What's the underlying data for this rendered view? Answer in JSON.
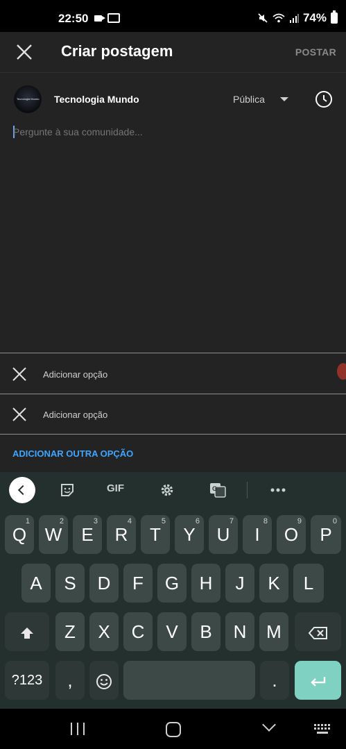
{
  "status_bar": {
    "time": "22:50",
    "battery": "74%",
    "notif_icon": "camera-icon, gallery-icon"
  },
  "app": {
    "title": "Criar postagem",
    "post_label": "POSTAR",
    "channel_name": "Tecnologia Mundo",
    "avatar_text": "Tecnologia Mundo",
    "visibility": "Pública",
    "composer_placeholder": "Pergunte à sua comunidade...",
    "options": [
      {
        "label": "Adicionar opção"
      },
      {
        "label": "Adicionar opção"
      }
    ],
    "add_option_label": "ADICIONAR OUTRA OPÇÃO",
    "accent_color": "#3ea6ff"
  },
  "keyboard": {
    "toolbar": {
      "gif_label": "GIF"
    },
    "row1": [
      {
        "k": "Q",
        "n": "1"
      },
      {
        "k": "W",
        "n": "2"
      },
      {
        "k": "E",
        "n": "3"
      },
      {
        "k": "R",
        "n": "4"
      },
      {
        "k": "T",
        "n": "5"
      },
      {
        "k": "Y",
        "n": "6"
      },
      {
        "k": "U",
        "n": "7"
      },
      {
        "k": "I",
        "n": "8"
      },
      {
        "k": "O",
        "n": "9"
      },
      {
        "k": "P",
        "n": "0"
      }
    ],
    "row2": [
      "A",
      "S",
      "D",
      "F",
      "G",
      "H",
      "J",
      "K",
      "L"
    ],
    "row3": [
      "Z",
      "X",
      "C",
      "V",
      "B",
      "N",
      "M"
    ],
    "numbers_label": "?123",
    "comma_label": ",",
    "period_label": ".",
    "enter_color": "#7fd1c1"
  }
}
